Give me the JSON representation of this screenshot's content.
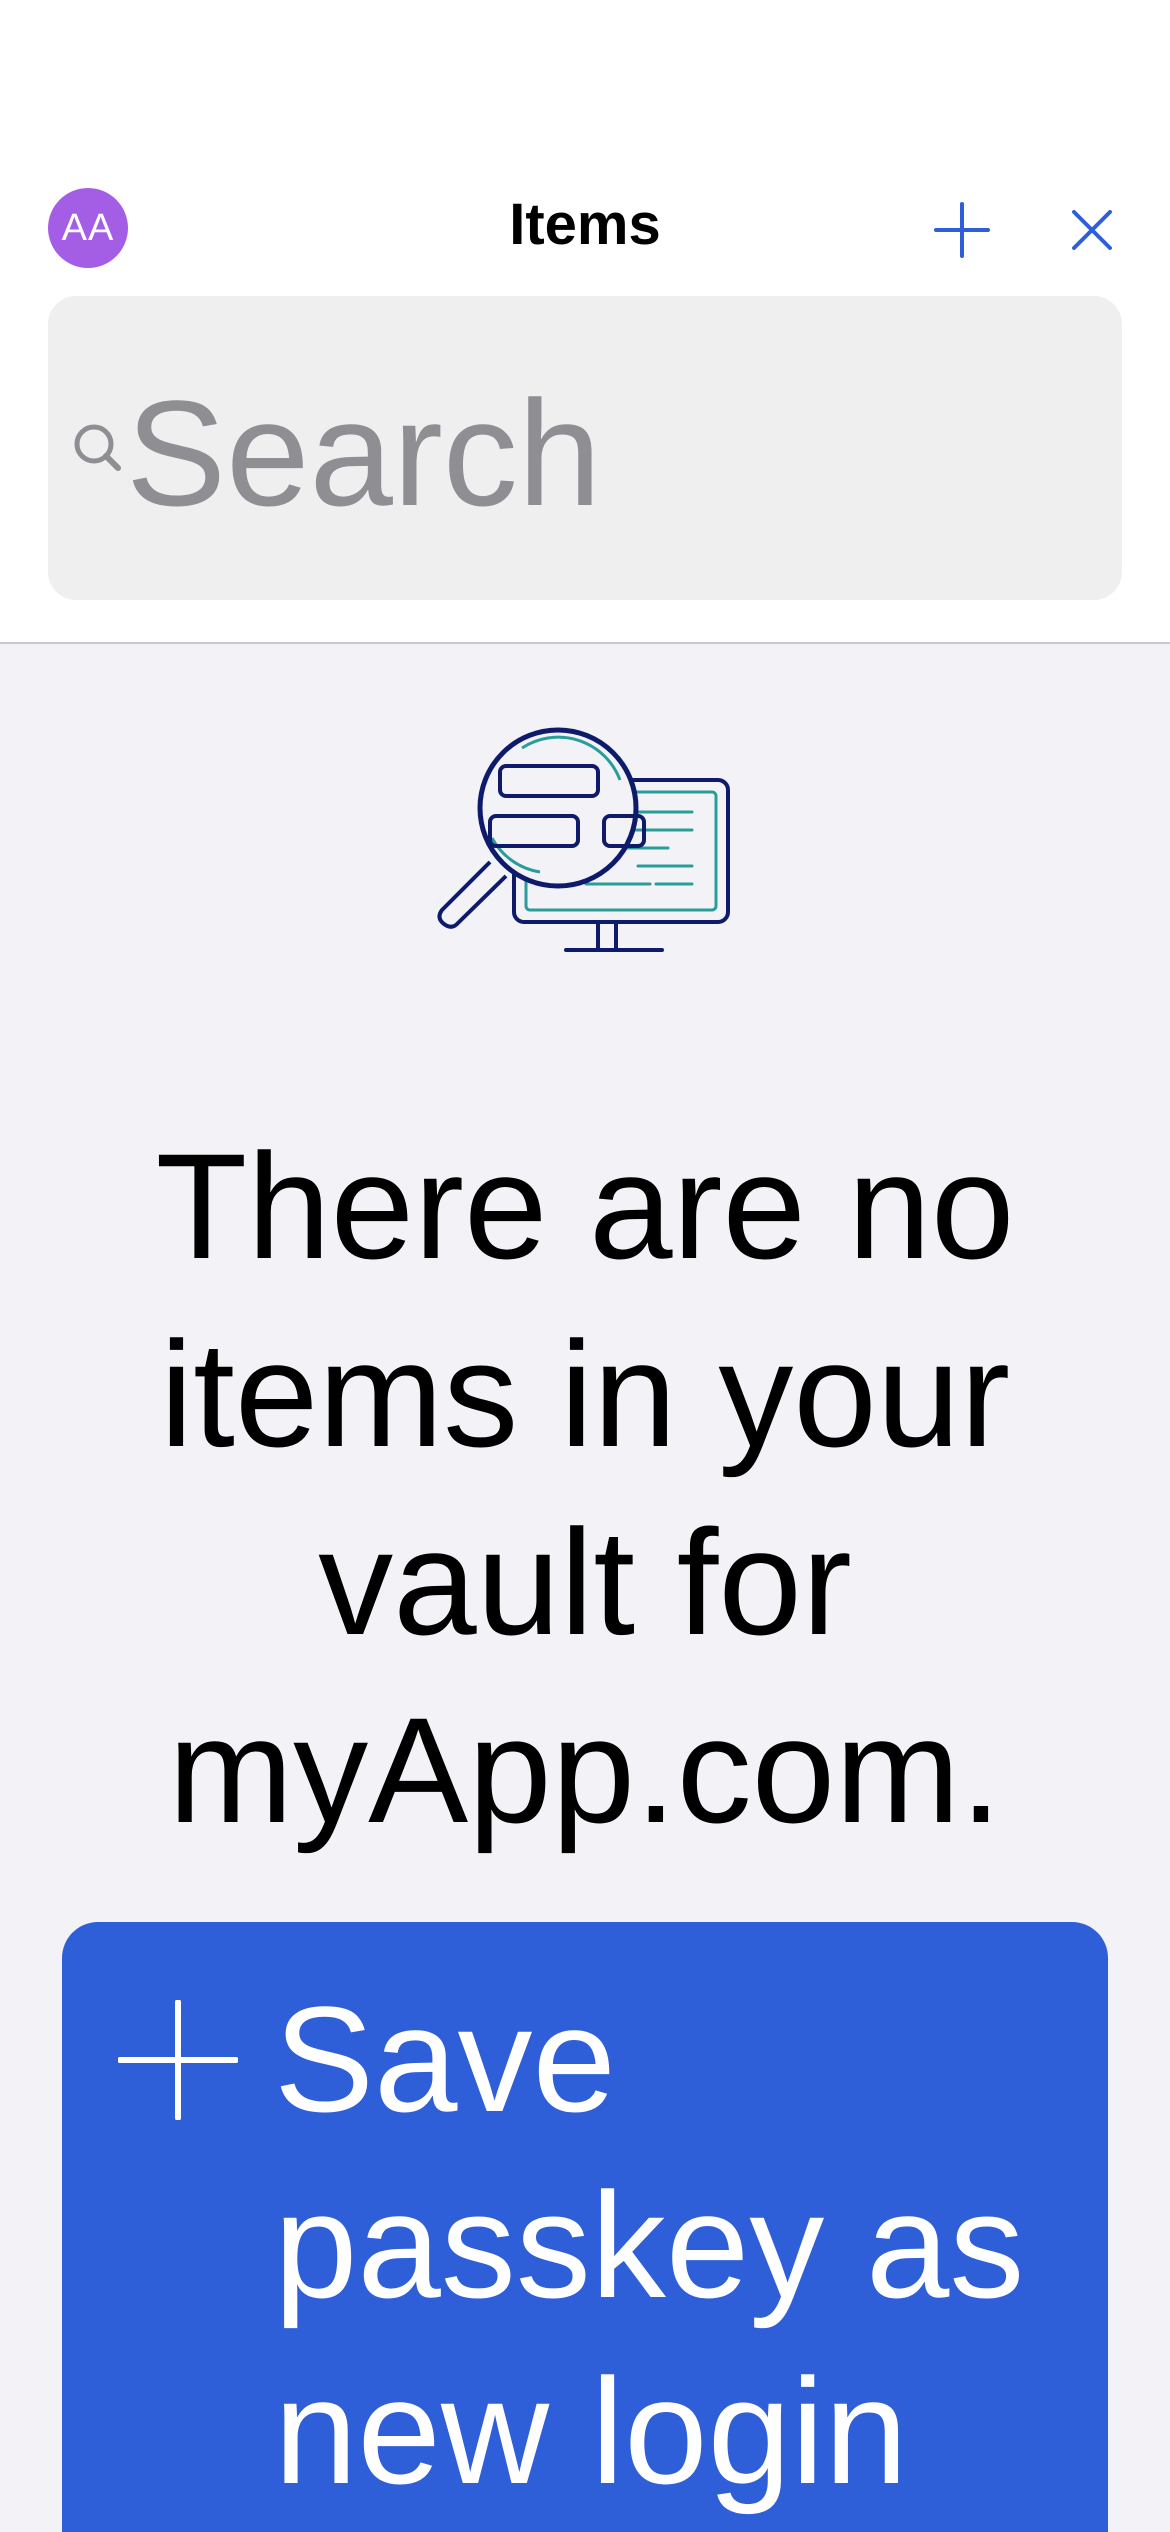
{
  "header": {
    "avatar_initials": "AA",
    "title": "Items",
    "add_icon": "plus-icon",
    "close_icon": "close-icon"
  },
  "search": {
    "placeholder": "Search",
    "icon": "search-icon"
  },
  "empty_state": {
    "illustration": "magnifier-over-monitor-illustration",
    "message": "There are no items in your vault for myApp.com."
  },
  "actions": {
    "save_passkey_label": "Save passkey as new login",
    "save_passkey_icon": "plus-icon"
  },
  "colors": {
    "accent": "#2f5fd8",
    "avatar": "#a45ee5",
    "background": "#f2f2f7",
    "illustration_outline": "#0e1b6b",
    "illustration_teal": "#2a9d9a"
  }
}
